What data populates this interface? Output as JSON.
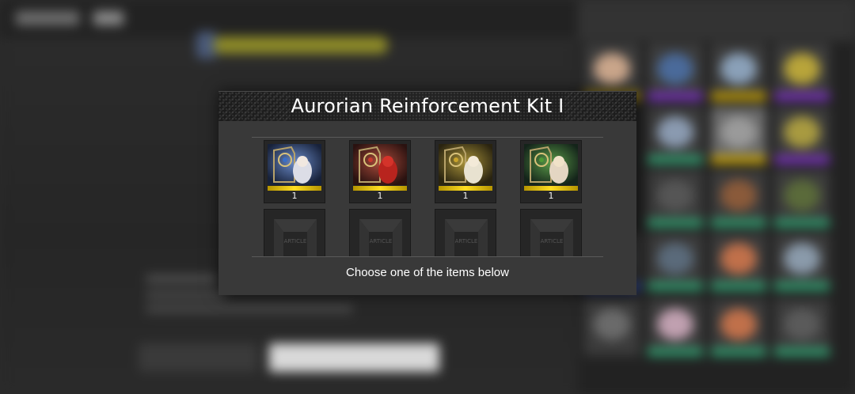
{
  "modal": {
    "title": "Aurorian Reinforcement Kit I",
    "caption": "Choose one of the items below",
    "items": [
      {
        "name": "Aurorian kit item (blue)",
        "quantity": "1",
        "accent": "#3a6fc7"
      },
      {
        "name": "Aurorian kit item (red)",
        "quantity": "1",
        "accent": "#c73a2e"
      },
      {
        "name": "Aurorian kit item (yellow)",
        "quantity": "1",
        "accent": "#c9a42c"
      },
      {
        "name": "Aurorian kit item (green)",
        "quantity": "1",
        "accent": "#4f9a35"
      }
    ],
    "empty_slot_label": "ARTICLE"
  },
  "colors": {
    "modal_bg": "#393939",
    "header_bg": "#1e1e1e",
    "rarity_gold": "#ffde22"
  }
}
